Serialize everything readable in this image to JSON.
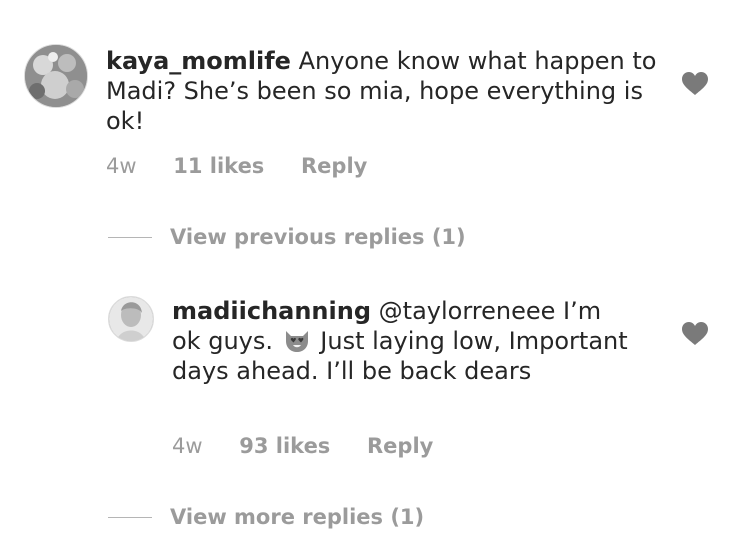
{
  "comments": [
    {
      "username": "kaya_momlife",
      "text": "Anyone know what happen to Madi? She’s been so mia, hope everything is ok!",
      "age": "4w",
      "likes": "11 likes",
      "reply": "Reply",
      "avatar_icon": "avatar-photo",
      "like_icon": "heart-icon"
    },
    {
      "username": "madiichanning",
      "text_before_emoji": "@taylorreneee I’m ok guys.",
      "emoji": "heart-eyes-cat-emoji",
      "text_after_emoji": "Just laying low, Important days ahead. I’ll be back dears",
      "age": "4w",
      "likes": "93 likes",
      "reply": "Reply",
      "avatar_icon": "avatar-photo",
      "like_icon": "heart-icon"
    }
  ],
  "view_previous_replies": "View previous replies (1)",
  "view_more_replies": "View more replies (1)",
  "colors": {
    "text": "#262626",
    "meta": "#9b9b9b",
    "heart": "#7a7a7a",
    "divider": "#b5b5b5"
  }
}
